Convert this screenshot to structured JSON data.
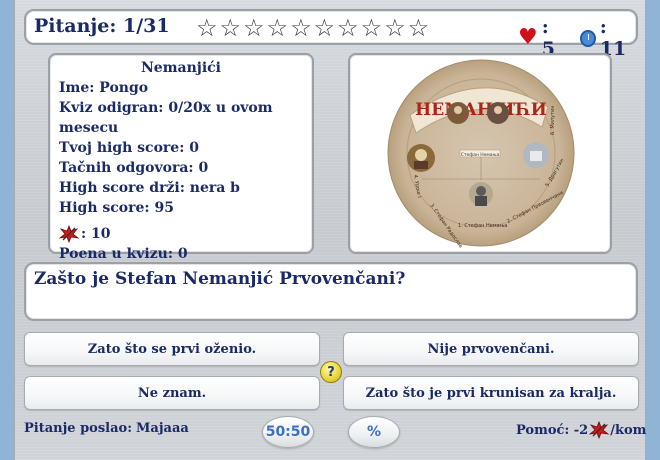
{
  "header": {
    "question_label": "Pitanje: 1/31",
    "stars_total": 10,
    "stars_filled": 0,
    "lives_label": ": 5",
    "time_label": ": 11",
    "icons": [
      "star-icon",
      "heart-icon",
      "clock-icon"
    ]
  },
  "info": {
    "title": "Nemanjići",
    "name": "Ime: Pongo",
    "played": "Kviz odigran: 0/20x u ovom mesecu",
    "your_high_score": "Tvoj high score: 0",
    "correct": "Tačnih odgovora: 0",
    "high_score_holder": "High score drži: nera b",
    "high_score": "High score: 95",
    "jokers_count": ": 10",
    "quiz_points": "Poena u kvizu: 0"
  },
  "image": {
    "banner_text": "НЕМАЊИЋИ",
    "center_text": "Стефан Немања",
    "rim_labels": [
      "1. Стефан Немања",
      "2. Стефан Првовенчани",
      "3. Стефан Радослав",
      "4. Урош I",
      "5. Драгутин",
      "6. Милутин"
    ]
  },
  "question": {
    "text": "Zašto je Stefan Nemanjić Prvovenčani?"
  },
  "answers": [
    "Zato što se prvi oženio.",
    "Nije prvovenčani.",
    "Ne znam.",
    "Zato što je prvi krunisan za kralja."
  ],
  "footer": {
    "sender_label": "Pitanje poslao:",
    "sender_name": "Majaaa",
    "fifty_label": "50:50",
    "percent_label": "%",
    "help_prefix": "Pomoć: -2",
    "help_suffix": "/kom"
  },
  "colors": {
    "text": "#1a2a66",
    "accent_blue": "#3a6ec8",
    "heart": "#d0101c",
    "joker_red": "#d41818"
  }
}
